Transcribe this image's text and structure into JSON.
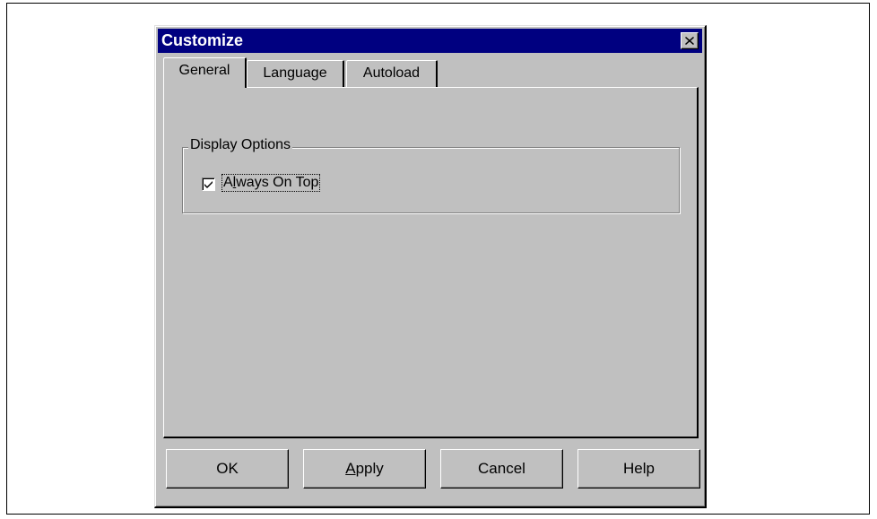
{
  "dialog": {
    "title": "Customize",
    "tabs": [
      {
        "label": "General",
        "active": true
      },
      {
        "label": "Language",
        "active": false
      },
      {
        "label": "Autoload",
        "active": false
      }
    ],
    "group": {
      "label": "Display Options",
      "checkbox": {
        "label_prefix": "A",
        "label_underlined": "l",
        "label_suffix": "ways On Top",
        "checked": true
      }
    },
    "buttons": {
      "ok": "OK",
      "apply_underlined": "A",
      "apply_rest": "pply",
      "cancel": "Cancel",
      "help": "Help"
    }
  },
  "colors": {
    "titlebar": "#000080",
    "face": "#c0c0c0"
  },
  "icons": {
    "close": "close-icon",
    "check": "checkmark-icon"
  }
}
